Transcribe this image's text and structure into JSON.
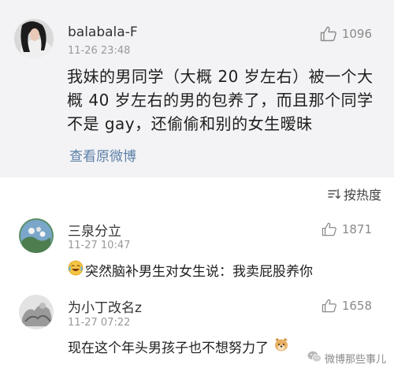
{
  "main_post": {
    "username": "balabala-F",
    "timestamp": "11-26 23:48",
    "like_count": "1096",
    "text": "我妹的男同学（大概 20 岁左右）被一个大概 40 岁左右的男的包养了，而且那个同学不是 gay，还偷偷和别的女生暧昧",
    "view_original_label": "查看原微博"
  },
  "sort": {
    "label": "按热度",
    "icon": "sort-icon"
  },
  "comments": [
    {
      "username": "三泉分立",
      "timestamp": "11-27 10:47",
      "like_count": "1871",
      "text": "突然脑补男生对女生说：我卖屁股养你",
      "emoji": "laughing-tears-emoji"
    },
    {
      "username": "为小丁改名z",
      "timestamp": "11-27 07:22",
      "like_count": "1658",
      "text": "现在这个年头男孩子也不想努力了",
      "emoji": "dog-emoji"
    }
  ],
  "watermark": {
    "text": "微博那些事儿",
    "icon": "wechat-icon"
  },
  "colors": {
    "main_post_bg": "#f3f3f5",
    "link": "#5b7fa8",
    "meta_gray": "#999999"
  }
}
